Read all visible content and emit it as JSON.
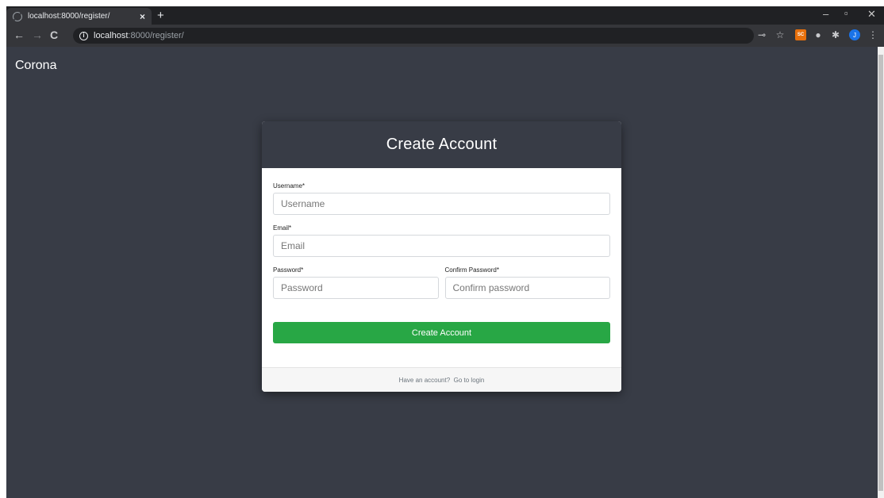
{
  "browser": {
    "tab_title": "localhost:8000/register/",
    "tab_close": "×",
    "new_tab": "+",
    "url_host": "localhost",
    "url_rest": ":8000/register/",
    "window_controls": {
      "minimize": "–",
      "maximize": "▫",
      "close": "✕"
    },
    "icons": [
      "back-icon",
      "forward-icon",
      "reload-icon",
      "info-icon",
      "key-icon",
      "star-icon",
      "extension-icon",
      "puzzle-icon",
      "profile-avatar",
      "menu-icon"
    ],
    "extension_badge": "SC",
    "profile_initial": "J"
  },
  "app": {
    "brand": "Corona"
  },
  "form": {
    "title": "Create Account",
    "username": {
      "label": "Username*",
      "placeholder": "Username",
      "value": ""
    },
    "email": {
      "label": "Email*",
      "placeholder": "Email",
      "value": ""
    },
    "password": {
      "label": "Password*",
      "placeholder": "Password",
      "value": ""
    },
    "confirm_password": {
      "label": "Confirm Password*",
      "placeholder": "Confirm password",
      "value": ""
    },
    "submit_label": "Create Account",
    "footer_prefix": "Have an account? ",
    "footer_link": "Go to login"
  },
  "colors": {
    "page_bg": "#383c46",
    "button_green": "#28a745",
    "card_bg": "#ffffff"
  }
}
